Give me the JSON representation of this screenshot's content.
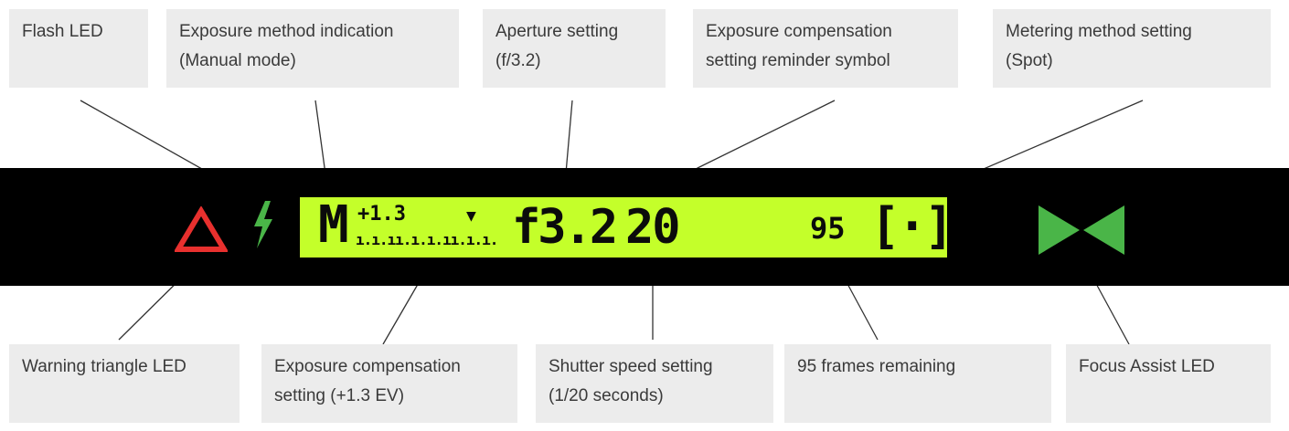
{
  "callouts": {
    "flash_led": {
      "lines": [
        "Flash LED"
      ]
    },
    "exposure_method": {
      "lines": [
        "Exposure method indication",
        "(Manual mode)"
      ]
    },
    "aperture": {
      "lines": [
        "Aperture setting",
        "(f/3.2)"
      ]
    },
    "exp_comp_reminder": {
      "lines": [
        "Exposure compensation",
        "setting reminder symbol"
      ]
    },
    "metering": {
      "lines": [
        "Metering method setting",
        "(Spot)"
      ]
    },
    "warning_led": {
      "lines": [
        "Warning triangle LED"
      ]
    },
    "exp_comp_setting": {
      "lines": [
        "Exposure compensation",
        "setting (+1.3 EV)"
      ]
    },
    "shutter": {
      "lines": [
        "Shutter speed setting",
        "(1/20 seconds)"
      ]
    },
    "frames": {
      "lines": [
        "95 frames remaining"
      ]
    },
    "focus_assist": {
      "lines": [
        "Focus Assist LED"
      ]
    }
  },
  "lcd": {
    "mode": "M",
    "exp_comp": "+1.3",
    "scale_ticks": "ı.ı.ıı.ı.ı.ıı.ı.ı.",
    "reminder": "▼",
    "aperture": "f3.2",
    "shutter": "20",
    "frames": "95",
    "metering": "[·]"
  },
  "icons": {
    "warning": "warning-triangle-icon",
    "flash": "flash-lightning-icon",
    "focus": "focus-assist-triangles-icon"
  },
  "colors": {
    "lcd_background": "#c4ff2a",
    "lcd_text": "#0b0b0b",
    "viewfinder": "#000000",
    "warning": "#e8302e",
    "flash": "#4ab548",
    "focus": "#4ab548",
    "callout_bg": "#ececec"
  }
}
